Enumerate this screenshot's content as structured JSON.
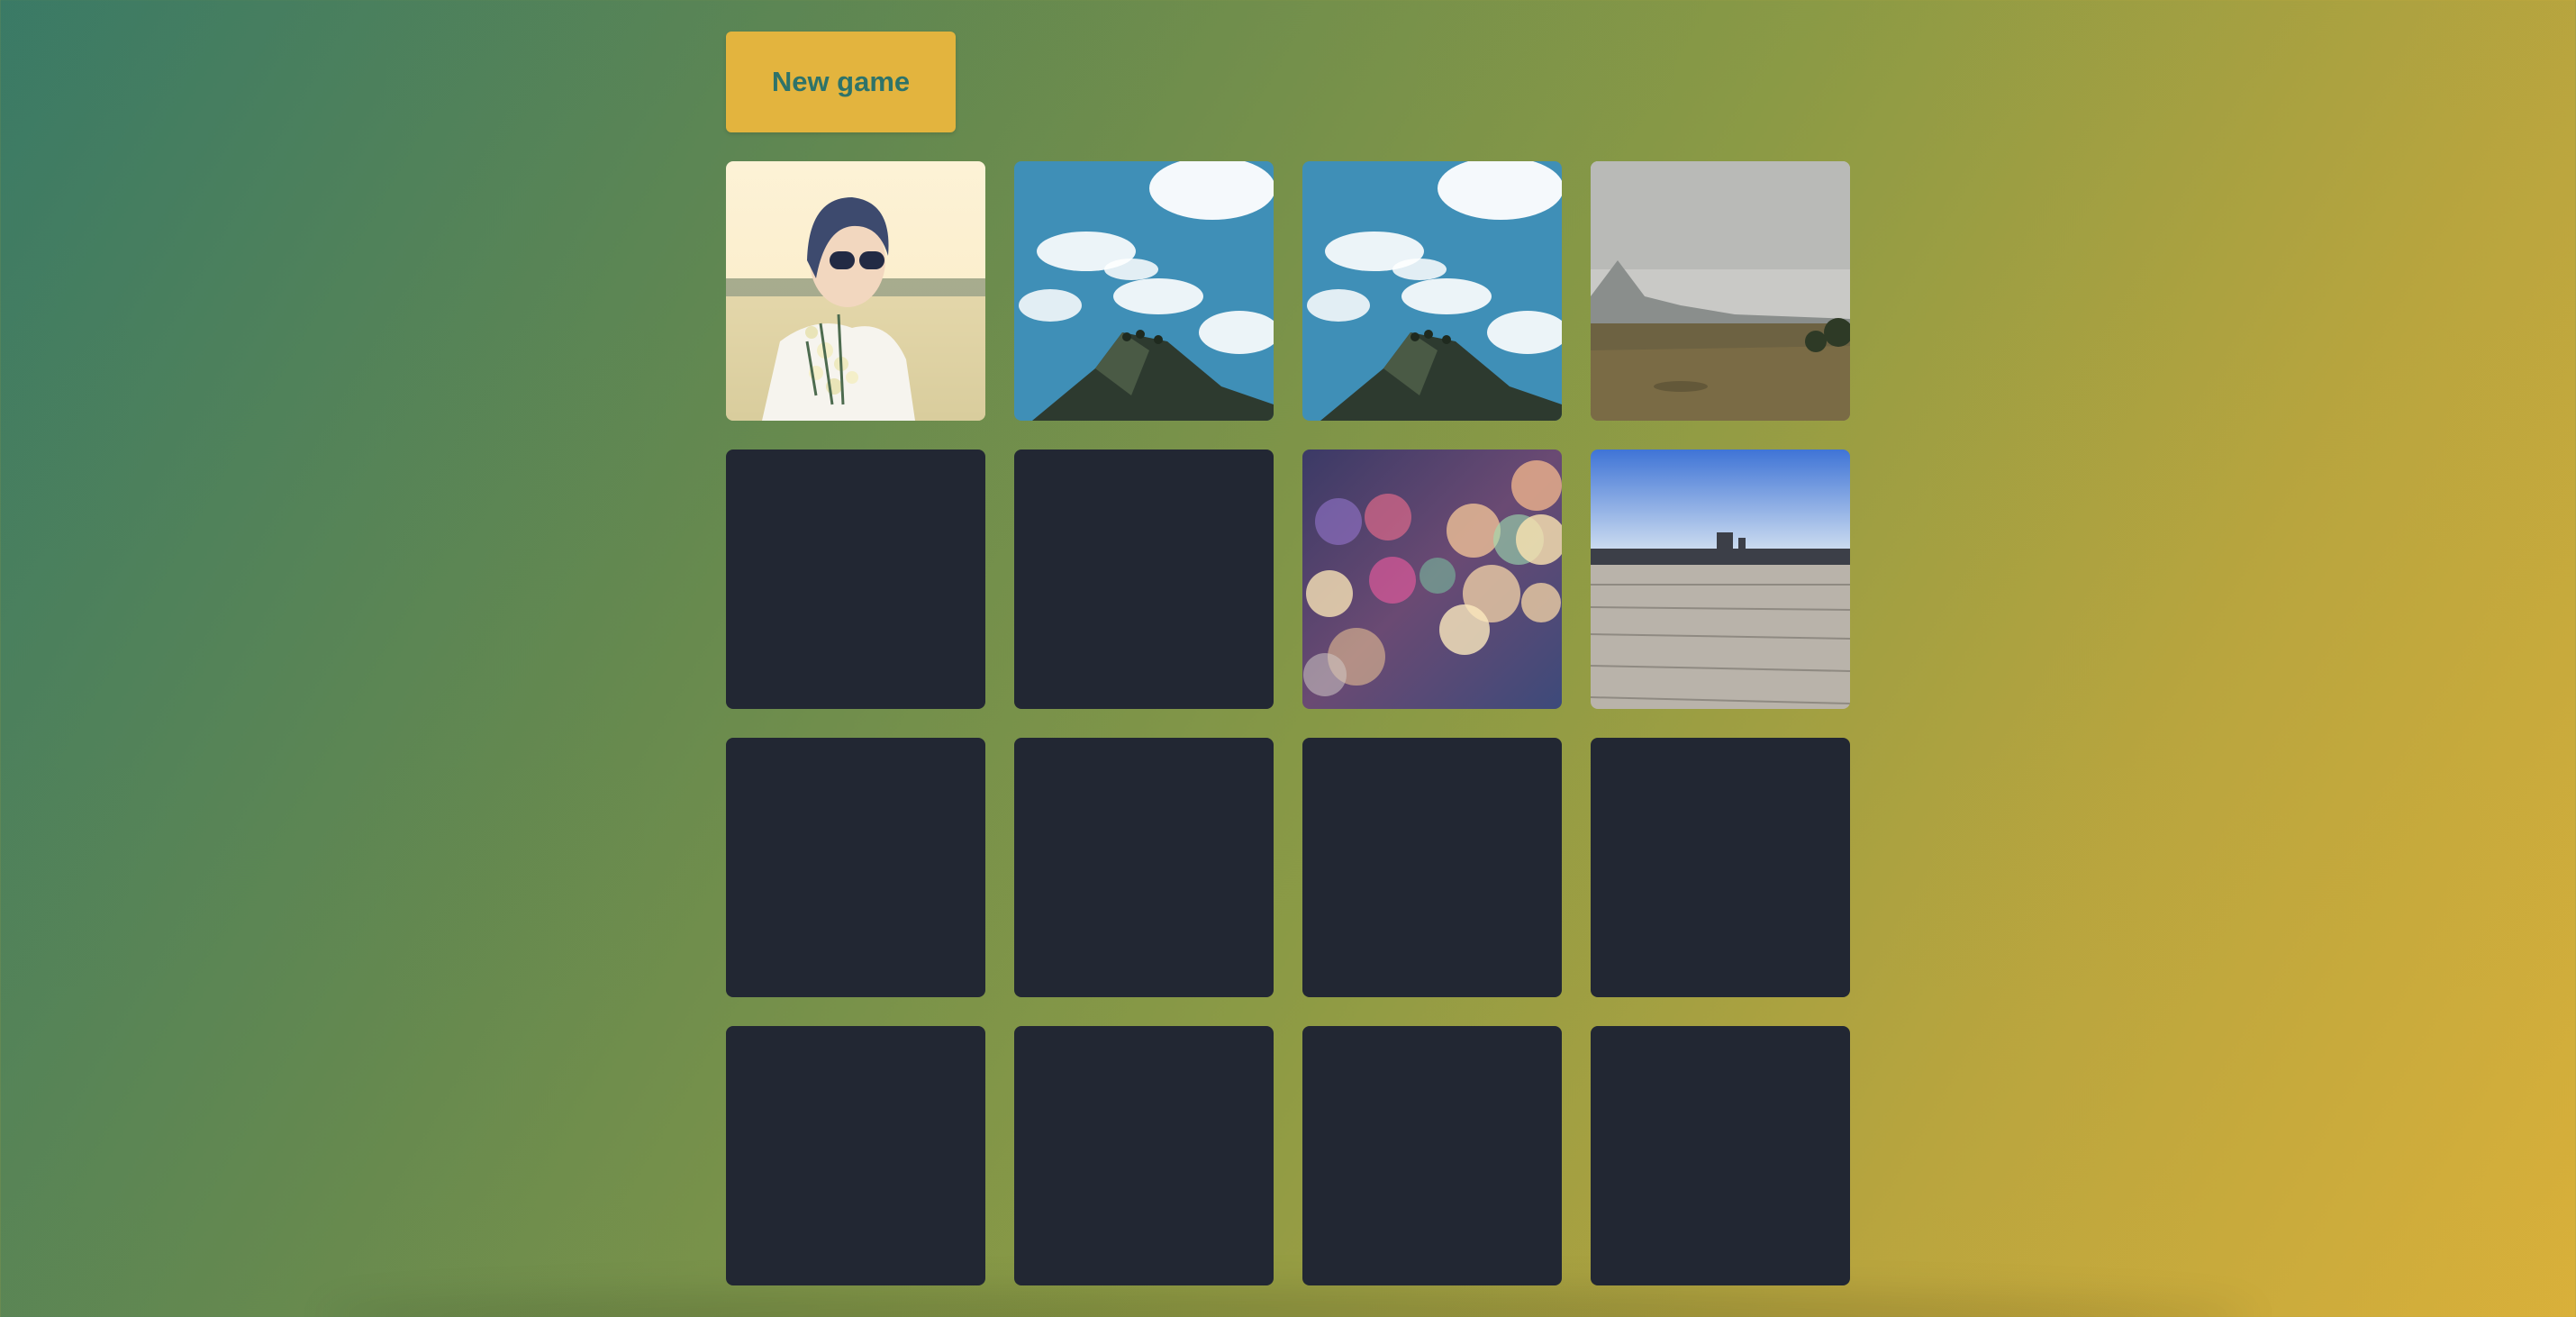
{
  "controls": {
    "new_game_label": "New game"
  },
  "board": {
    "rows": 4,
    "columns": 4,
    "cards": [
      {
        "state": "face-up",
        "image": "girl-with-flowers"
      },
      {
        "state": "face-up",
        "image": "sky-mountain"
      },
      {
        "state": "face-up",
        "image": "sky-mountain"
      },
      {
        "state": "face-up",
        "image": "grassland-mountains"
      },
      {
        "state": "face-down",
        "image": null
      },
      {
        "state": "face-down",
        "image": null
      },
      {
        "state": "face-up",
        "image": "bokeh-lights"
      },
      {
        "state": "face-up",
        "image": "wooden-deck"
      },
      {
        "state": "face-down",
        "image": null
      },
      {
        "state": "face-down",
        "image": null
      },
      {
        "state": "face-down",
        "image": null
      },
      {
        "state": "face-down",
        "image": null
      },
      {
        "state": "face-down",
        "image": null
      },
      {
        "state": "face-down",
        "image": null
      },
      {
        "state": "face-down",
        "image": null
      },
      {
        "state": "face-down",
        "image": null
      }
    ]
  },
  "colors": {
    "button_bg": "#e3b43e",
    "button_text": "#2e7369",
    "card_back": "#222733",
    "background_start": "#3a7a66",
    "background_end": "#d9b03a"
  }
}
